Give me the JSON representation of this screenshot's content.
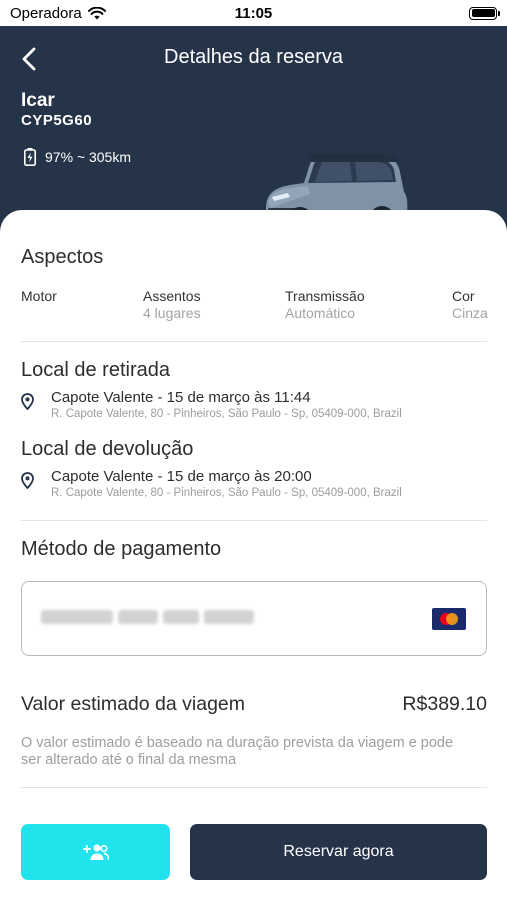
{
  "status": {
    "carrier": "Operadora",
    "time": "11:05"
  },
  "header": {
    "title": "Detalhes da reserva"
  },
  "car": {
    "name": "Icar",
    "plate": "CYP5G60",
    "range": "97% ~ 305km",
    "battery_percent": 97
  },
  "aspects": {
    "title": "Aspectos",
    "items": [
      {
        "label": "Motor",
        "value": ""
      },
      {
        "label": "Assentos",
        "value": "4 lugares"
      },
      {
        "label": "Transmissão",
        "value": "Automático"
      },
      {
        "label": "Cor",
        "value": "Cinza"
      }
    ]
  },
  "pickup": {
    "title": "Local de retirada",
    "main": "Capote Valente - 15 de março às 11:44",
    "address": "R. Capote Valente, 80 - Pinheiros, São Paulo - Sp, 05409-000, Brazil"
  },
  "dropoff": {
    "title": "Local de devolução",
    "main": "Capote Valente - 15 de março às 20:00",
    "address": "R. Capote Valente, 80 - Pinheiros, São Paulo - Sp, 05409-000, Brazil"
  },
  "payment": {
    "title": "Método de pagamento",
    "card_icon": "mastercard-icon"
  },
  "estimate": {
    "title": "Valor estimado da viagem",
    "value": "R$389.10",
    "note": "O valor estimado é baseado na duração prevista da viagem e pode ser alterado até o final da mesma"
  },
  "actions": {
    "invite_icon": "add-group-icon",
    "reserve_label": "Reservar agora"
  },
  "colors": {
    "header_bg": "#26344a",
    "accent": "#22e3ec",
    "primary_button": "#26344a"
  }
}
